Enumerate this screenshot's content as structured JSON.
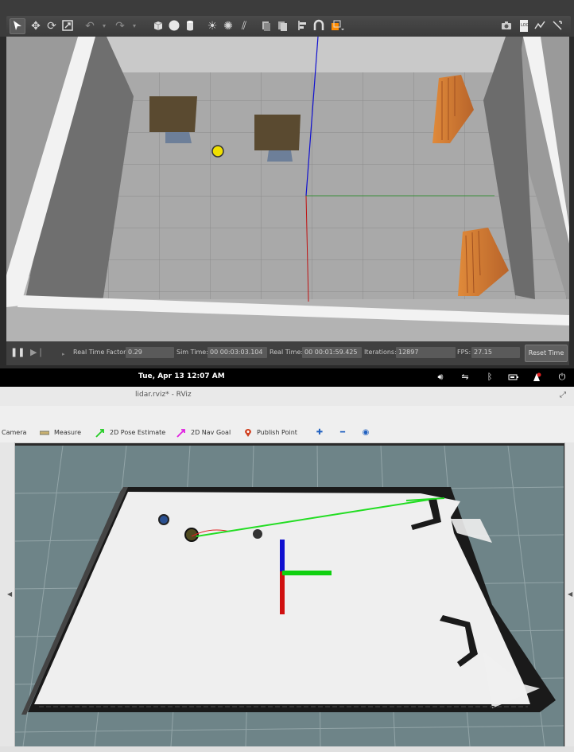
{
  "gazebo": {
    "toolbar_icons": [
      "select-arrow-icon",
      "translate-icon",
      "rotate-icon",
      "scale-icon",
      "undo-icon",
      "redo-icon",
      "box-icon",
      "sphere-icon",
      "cylinder-icon",
      "point-light-icon",
      "spot-light-icon",
      "directional-light-icon",
      "copy-icon",
      "paste-icon",
      "align-icon",
      "snap-icon",
      "view-angle-icon",
      "screenshot-icon",
      "log-icon",
      "plot-icon",
      "more-icon"
    ],
    "status": {
      "real_time_factor_label": "Real Time Factor:",
      "real_time_factor": "0.29",
      "sim_time_label": "Sim Time:",
      "sim_time": "00 00:03:03.104",
      "real_time_label": "Real Time:",
      "real_time": "00 00:01:59.425",
      "iterations_label": "Iterations:",
      "iterations": "12897",
      "fps_label": "FPS:",
      "fps": "27.15",
      "reset_label": "Reset Time"
    }
  },
  "panel": {
    "date": "Tue, Apr 13",
    "time": "12:07 AM"
  },
  "rviz": {
    "window_title": "lidar.rviz* - RViz",
    "tools": {
      "camera": "Camera",
      "measure": "Measure",
      "pose_estimate": "2D Pose Estimate",
      "nav_goal": "2D Nav Goal",
      "publish_point": "Publish Point"
    }
  },
  "colors": {
    "accent_orange": "#ff8c00",
    "pose_green": "#22cc22",
    "nav_magenta": "#e020e0",
    "publish_red": "#d04020",
    "axis_red": "#d01010",
    "axis_green": "#10d010",
    "axis_blue": "#1010d0"
  }
}
